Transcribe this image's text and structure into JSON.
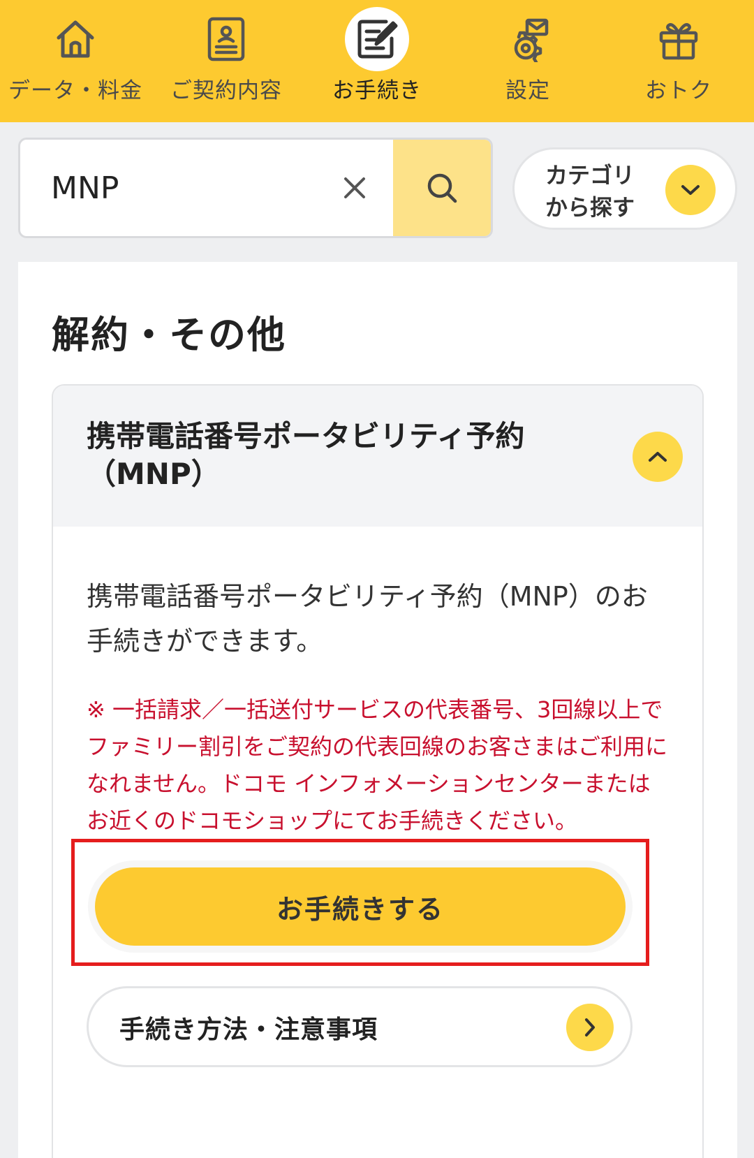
{
  "nav": {
    "items": [
      {
        "label": "データ・料金",
        "icon": "home-icon",
        "active": false
      },
      {
        "label": "ご契約内容",
        "icon": "contract-document-icon",
        "active": false
      },
      {
        "label": "お手続き",
        "icon": "edit-form-icon",
        "active": true
      },
      {
        "label": "設定",
        "icon": "settings-gear-icon",
        "active": false
      },
      {
        "label": "おトク",
        "icon": "gift-icon",
        "active": false
      }
    ]
  },
  "search": {
    "value": "MNP",
    "placeholder": ""
  },
  "category": {
    "label": "カテゴリ\nから探す"
  },
  "section": {
    "title": "解約・その他"
  },
  "accordion": {
    "title": "携帯電話番号ポータビリティ予約（MNP）",
    "expanded": true,
    "description": "携帯電話番号ポータビリティ予約（MNP）のお手続きができます。",
    "note": "※ 一括請求／一括送付サービスの代表番号、3回線以上でファミリー割引をご契約の代表回線のお客さまはご利用になれません。ドコモ インフォメーションセンターまたはお近くのドコモショップにてお手続きください。",
    "cta_label": "お手続きする",
    "link_label": "手続き方法・注意事項"
  },
  "colors": {
    "brand_yellow": "#fdca30",
    "light_yellow": "#fdd94a",
    "note_red": "#c8102e",
    "highlight_red": "#e51d1d"
  }
}
